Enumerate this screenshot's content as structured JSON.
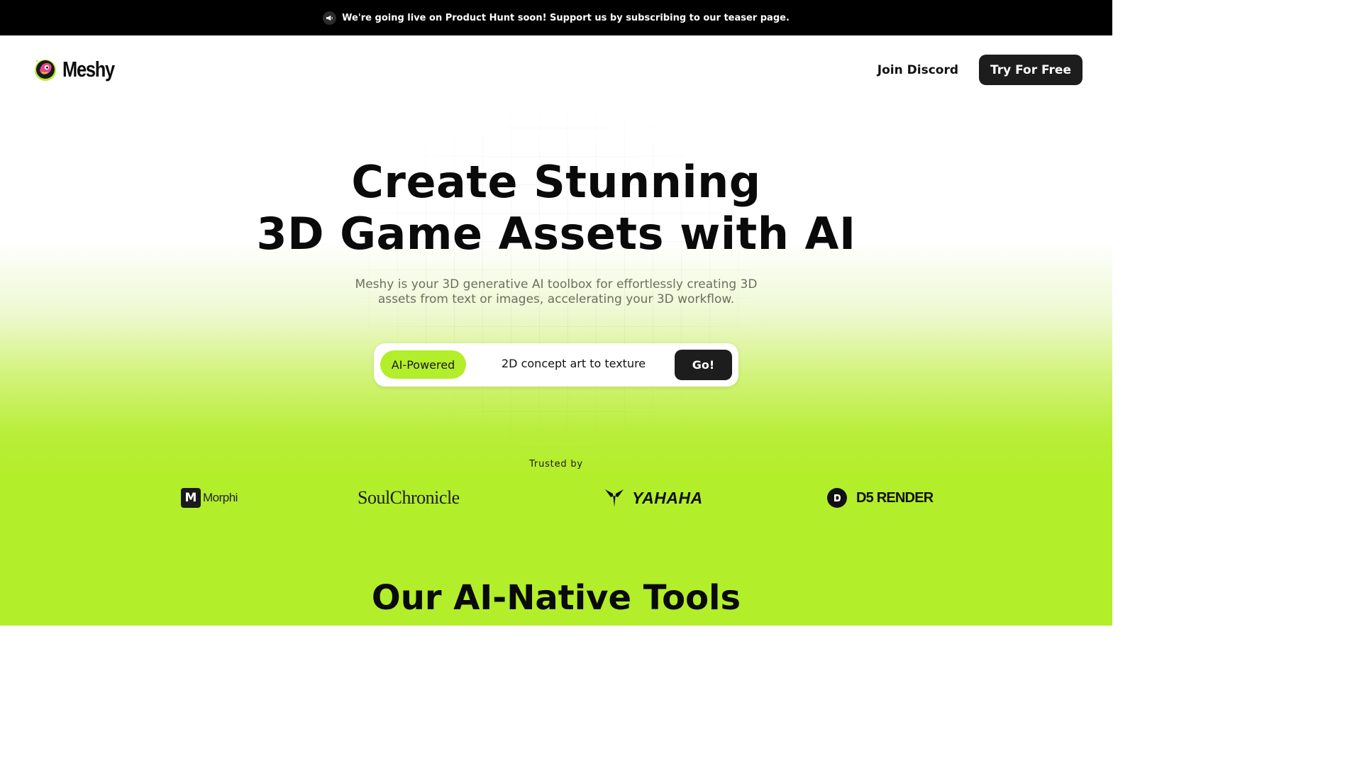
{
  "announcement": {
    "icon": "megaphone-icon",
    "text": "We're going live on Product Hunt soon! Support us by subscribing to our teaser page."
  },
  "nav": {
    "logo_text": "Meshy",
    "join_discord": "Join Discord",
    "try_free": "Try For Free"
  },
  "hero": {
    "headline_line1": "Create Stunning",
    "headline_line2": "3D Game Assets with AI",
    "subtitle": "Meshy is your 3D generative AI toolbox for effortlessly creating 3D assets from text or images, accelerating your 3D workflow.",
    "pill_label": "AI-Powered",
    "prompt_text": "2D concept art to texture",
    "go_label": "Go!"
  },
  "trusted": {
    "label": "Trusted by",
    "logos": [
      "Morphi",
      "SoulChronicle",
      "YAHAHA",
      "D5 RENDER"
    ],
    "morphi_mark": "M"
  },
  "tools": {
    "heading": "Our AI-Native Tools"
  },
  "colors": {
    "accent": "#b3ee2a",
    "dark": "#1d1d1d",
    "announcement_bg": "#000000"
  }
}
